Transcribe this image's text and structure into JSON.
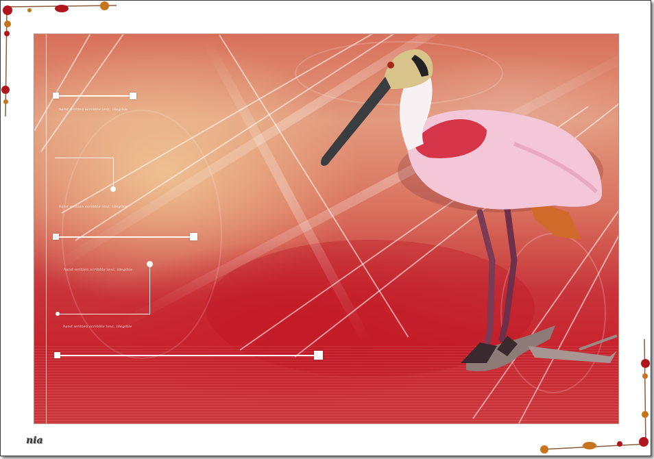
{
  "signature": "nia",
  "colors": {
    "frame_border": "#3a3a3a",
    "background_warm": "#e29a7e",
    "background_red": "#c8242e",
    "plumage_pink": "#f3c6d8",
    "wing_red": "#d2243a",
    "bead_amber": "#c8741c",
    "bead_red": "#b0141c"
  },
  "decorative_text_blocks": [
    "hand written scribble text, illegible",
    "hand written scribble text, illegible",
    "hand written scribble text, illegible",
    "hand written scribble text, illegible"
  ]
}
